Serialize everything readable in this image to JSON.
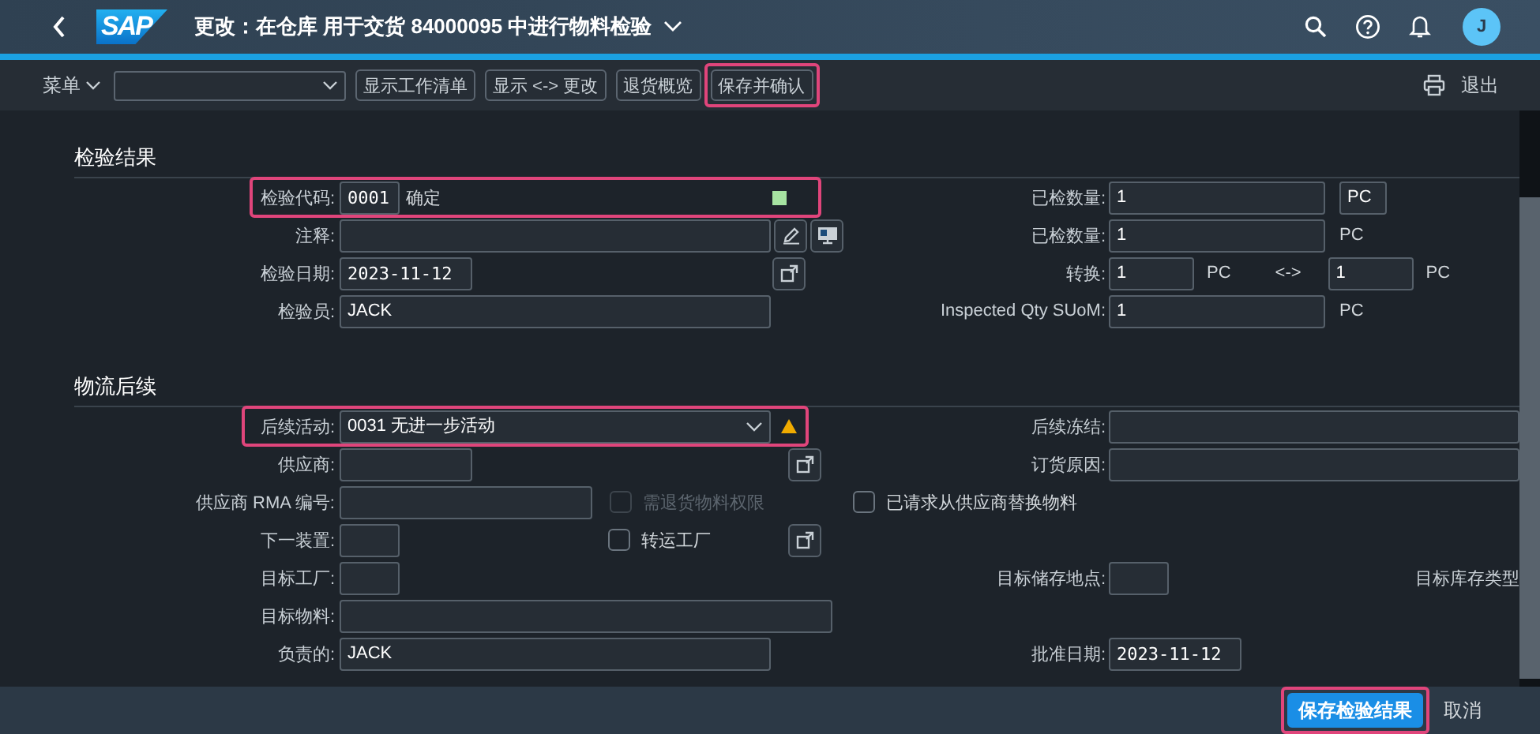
{
  "shell": {
    "title": "更改：在仓库 用于交货 84000095 中进行物料检验",
    "logo": "SAP",
    "avatar": "J"
  },
  "toolbar": {
    "menu": "菜单",
    "buttons": [
      {
        "label": "显示工作清单",
        "highlighted": false
      },
      {
        "label": "显示 <-> 更改",
        "highlighted": false
      },
      {
        "label": "退货概览",
        "highlighted": false
      },
      {
        "label": "保存并确认",
        "highlighted": true
      }
    ],
    "exit": "退出"
  },
  "sections": [
    {
      "title": "检验结果",
      "rows": [
        {
          "highlighted": true,
          "left": {
            "label": "检验代码:",
            "items": [
              {
                "kind": "code-input",
                "value": "0001"
              },
              {
                "kind": "description",
                "text": "确定"
              },
              {
                "kind": "success-light"
              }
            ]
          },
          "right": {
            "label": "已检数量:",
            "items": [
              {
                "kind": "input",
                "value": "1"
              },
              {
                "kind": "unit-field",
                "value": "PC"
              }
            ]
          }
        },
        {
          "highlighted": false,
          "left": {
            "label": "注释:",
            "items": [
              {
                "kind": "input"
              },
              {
                "kind": "edit-button"
              },
              {
                "kind": "screen-button"
              }
            ]
          },
          "right": {
            "label": "已检数量:",
            "items": [
              {
                "kind": "input",
                "value": "1"
              },
              {
                "kind": "unit",
                "text": "PC"
              }
            ]
          }
        },
        {
          "highlighted": false,
          "left": {
            "label": "检验日期:",
            "items": [
              {
                "kind": "date-input",
                "value": "2023-11-12"
              },
              {
                "kind": "open-button"
              }
            ]
          },
          "right": {
            "label": "转换:",
            "items": [
              {
                "kind": "input",
                "value": "1"
              },
              {
                "kind": "unit",
                "text": "PC"
              },
              {
                "kind": "separator",
                "text": "<->"
              },
              {
                "kind": "input",
                "value": "1"
              },
              {
                "kind": "unit",
                "text": "PC"
              }
            ]
          }
        },
        {
          "highlighted": false,
          "left": {
            "label": "检验员:",
            "items": [
              {
                "kind": "input",
                "value": "JACK"
              }
            ]
          },
          "right": {
            "label": "Inspected Qty SUoM:",
            "items": [
              {
                "kind": "input",
                "value": "1"
              },
              {
                "kind": "unit",
                "text": "PC"
              }
            ]
          }
        }
      ]
    },
    {
      "title": "物流后续",
      "rows": [
        {
          "highlighted": true,
          "left": {
            "label": "后续活动:",
            "items": [
              {
                "kind": "select",
                "value": "0031 无进一步活动"
              },
              {
                "kind": "warning"
              }
            ]
          },
          "right": {
            "label": "后续冻结:",
            "items": [
              {
                "kind": "input"
              }
            ]
          }
        },
        {
          "highlighted": false,
          "left": {
            "label": "供应商:",
            "items": [
              {
                "kind": "input"
              },
              {
                "kind": "open-button"
              }
            ]
          },
          "right": {
            "label": "订货原因:",
            "items": [
              {
                "kind": "input"
              }
            ]
          }
        },
        {
          "highlighted": false,
          "left": {
            "label": "供应商 RMA 编号:",
            "items": [
              {
                "kind": "input"
              },
              {
                "kind": "checkbox",
                "label": "需退货物料权限",
                "checked": false,
                "disabled": true
              }
            ]
          },
          "right": {
            "items": [
              {
                "kind": "checkbox",
                "label": "已请求从供应商替换物料",
                "checked": false,
                "disabled": false
              }
            ]
          }
        },
        {
          "highlighted": false,
          "left": {
            "label": "下一装置:",
            "items": [
              {
                "kind": "input"
              },
              {
                "kind": "checkbox",
                "label": "转运工厂",
                "checked": false,
                "disabled": false
              },
              {
                "kind": "open-button"
              }
            ]
          }
        },
        {
          "highlighted": false,
          "left": {
            "label": "目标工厂:",
            "items": [
              {
                "kind": "input"
              }
            ]
          },
          "right": {
            "label": "目标储存地点:",
            "items": [
              {
                "kind": "input"
              },
              {
                "kind": "label",
                "text": "目标库存类型"
              }
            ]
          }
        },
        {
          "highlighted": false,
          "left": {
            "label": "目标物料:",
            "items": [
              {
                "kind": "input"
              }
            ]
          }
        },
        {
          "highlighted": false,
          "left": {
            "label": "负责的:",
            "items": [
              {
                "kind": "input",
                "value": "JACK"
              }
            ]
          },
          "right": {
            "label": "批准日期:",
            "items": [
              {
                "kind": "date-input",
                "value": "2023-11-12"
              }
            ]
          }
        }
      ]
    }
  ],
  "footer": {
    "buttons": [
      {
        "label": "保存检验结果",
        "kind": "primary",
        "highlighted": true
      },
      {
        "label": "取消",
        "kind": "ghost",
        "highlighted": false
      }
    ]
  }
}
